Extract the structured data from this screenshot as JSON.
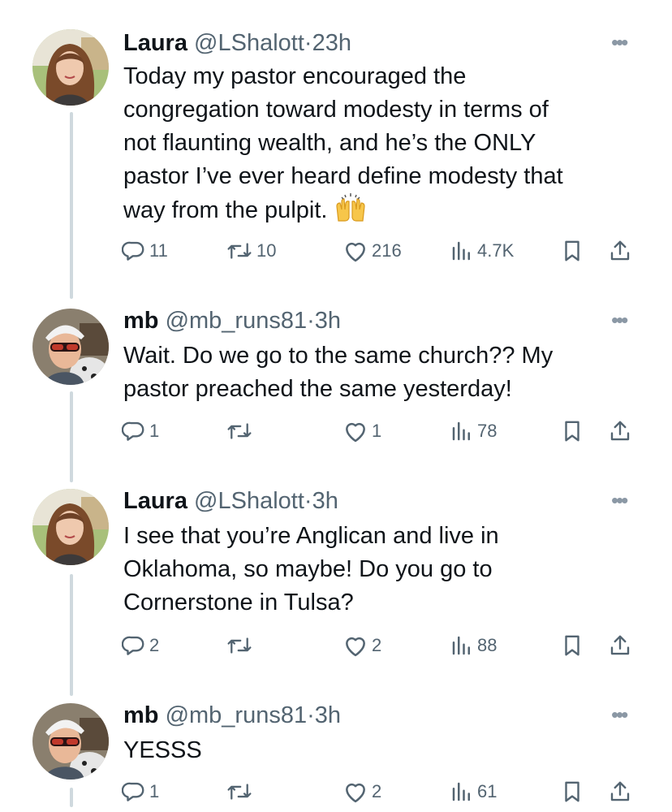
{
  "tweets": [
    {
      "name": "Laura",
      "handle": "@LShalott",
      "dot": "·",
      "time": "23h",
      "text": "Today my pastor encouraged the congregation toward modesty in terms of not flaunting wealth, and he’s the ONLY pastor I’ve ever heard define modesty that way from the pulpit.",
      "lines": [
        "Today my pastor encouraged the",
        "congregation toward modesty in terms of",
        "not flaunting wealth, and he’s the ONLY",
        "pastor I’ve ever heard define modesty that",
        "way from the pulpit."
      ],
      "emoji": "raising-hands",
      "replies": "11",
      "reposts": "10",
      "likes": "216",
      "views": "4.7K",
      "avatar": "woman-long-hair"
    },
    {
      "name": "mb",
      "handle": "@mb_runs81",
      "dot": "·",
      "time": "3h",
      "text": "Wait. Do we go to the same church?? My pastor preached the same yesterday!",
      "lines": [
        "Wait. Do we go to the same church?? My",
        "pastor preached the same yesterday!"
      ],
      "replies": "1",
      "reposts": "",
      "likes": "1",
      "views": "78",
      "avatar": "person-cap-sunglasses"
    },
    {
      "name": "Laura",
      "handle": "@LShalott",
      "dot": "·",
      "time": "3h",
      "text": "I see that you’re Anglican and live in Oklahoma, so maybe! Do you go to Cornerstone in Tulsa?",
      "lines": [
        "I see that you’re Anglican and live in",
        "Oklahoma, so maybe! Do you go to",
        "Cornerstone in Tulsa?"
      ],
      "replies": "2",
      "reposts": "",
      "likes": "2",
      "views": "88",
      "avatar": "woman-long-hair"
    },
    {
      "name": "mb",
      "handle": "@mb_runs81",
      "dot": "·",
      "time": "3h",
      "text": "YESSS",
      "lines": [
        "YESSS"
      ],
      "replies": "1",
      "reposts": "",
      "likes": "2",
      "views": "61",
      "avatar": "person-cap-sunglasses"
    }
  ],
  "more_label": "•••",
  "colors": {
    "text": "#0f1419",
    "secondary": "#536471",
    "thread_line": "#cfd9de"
  }
}
